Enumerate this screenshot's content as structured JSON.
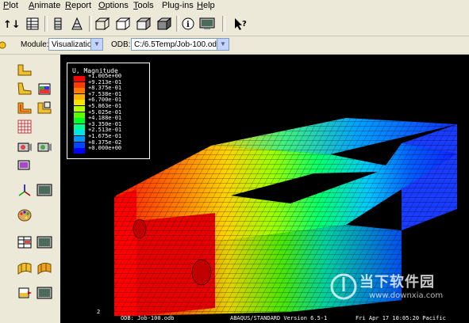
{
  "menu": {
    "items": [
      {
        "key": "P",
        "rest": "lot",
        "pre": ""
      },
      {
        "key": "A",
        "rest": "nimate",
        "pre": ""
      },
      {
        "key": "R",
        "rest": "eport",
        "pre": ""
      },
      {
        "key": "O",
        "rest": "ptions",
        "pre": ""
      },
      {
        "key": "T",
        "rest": "ools",
        "pre": ""
      },
      {
        "key": "g",
        "rest": "-ins",
        "pre": "Plu"
      },
      {
        "key": "H",
        "rest": "elp",
        "pre": ""
      }
    ]
  },
  "context": {
    "module_label": "Module:",
    "module_value": "Visualization",
    "odb_label": "ODB:",
    "odb_value": "C:/6.5Temp/Job-100.odb"
  },
  "legend": {
    "title": "U, Magnitude",
    "entries": [
      {
        "value": "+1.005e+00",
        "color": "#ff0000"
      },
      {
        "value": "+9.213e-01",
        "color": "#ff3c00"
      },
      {
        "value": "+8.375e-01",
        "color": "#ff7a00"
      },
      {
        "value": "+7.538e-01",
        "color": "#ffb400"
      },
      {
        "value": "+6.700e-01",
        "color": "#f5e600"
      },
      {
        "value": "+5.863e-01",
        "color": "#b8ff00"
      },
      {
        "value": "+5.025e-01",
        "color": "#5aff00"
      },
      {
        "value": "+4.188e-01",
        "color": "#00ff28"
      },
      {
        "value": "+3.350e-01",
        "color": "#00ff96"
      },
      {
        "value": "+2.513e-01",
        "color": "#00e6e6"
      },
      {
        "value": "+1.675e-01",
        "color": "#0096ff"
      },
      {
        "value": "+8.375e-02",
        "color": "#0046ff"
      },
      {
        "value": "+0.000e+00",
        "color": "#0000ff"
      }
    ]
  },
  "status": {
    "step_number": "2",
    "odb_text": "ODB: Job-100.odb",
    "version_text": "ABAQUS/STANDARD Version 6.5-1",
    "date_text": "Fri Apr 17 10:05:20 Pacific"
  },
  "watermark": {
    "brand": "当下软件园",
    "url": "www.downxia.com"
  },
  "icons": {
    "toolbar": [
      "sort-icon",
      "grid-icon",
      "mesh-icon",
      "cone-icon",
      "box-wire-icon",
      "box-solid-icon",
      "box-shaded-icon",
      "box-edges-icon",
      "info-icon",
      "monitor-icon",
      "help-pointer-icon"
    ],
    "side": [
      "undeformed-plot-icon",
      "deformed-plot-icon",
      "contour-plot-icon",
      "symbol-plot-icon",
      "overlay-icon",
      "material-orientation-icon",
      "animation-scale-icon",
      "animation-time-icon",
      "animation-harmonic-icon",
      "xy-plot-icon",
      "triad-icon",
      "view-cut-icon",
      "palette-icon",
      "table-icon",
      "field-output-icon",
      "display-group-icon",
      "shape-icon",
      "section-icon",
      "common-options-icon"
    ]
  }
}
